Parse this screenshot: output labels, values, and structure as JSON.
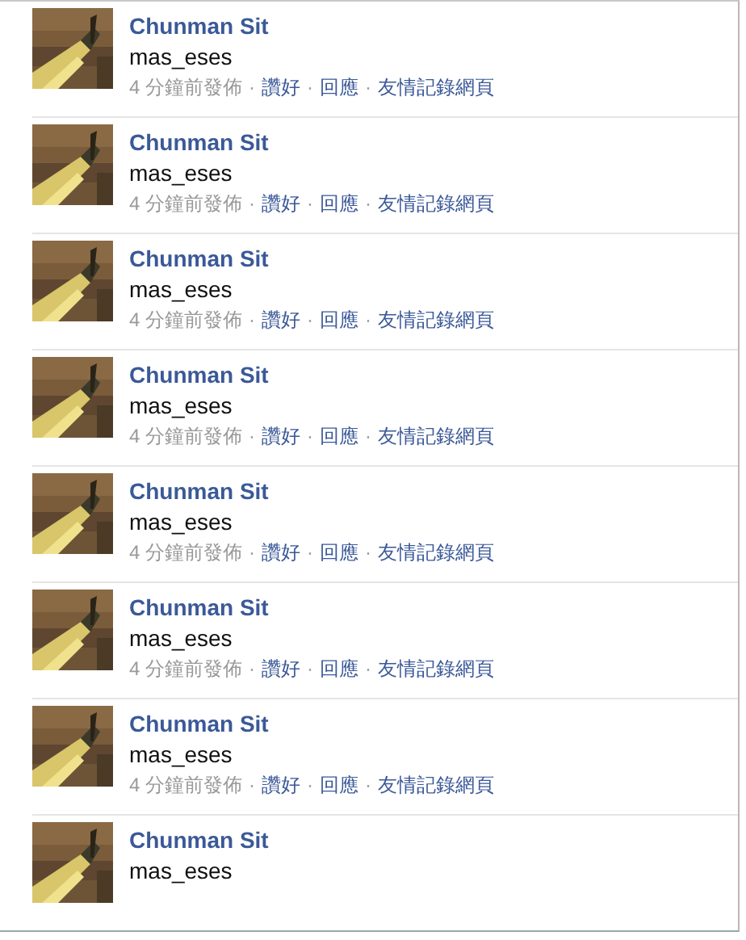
{
  "stories": [
    {
      "name": "Chunman Sit",
      "text": "mas_eses",
      "meta": [
        {
          "kind": "time",
          "text": "4 分鐘前發佈"
        },
        {
          "kind": "sep",
          "text": "·"
        },
        {
          "kind": "link",
          "text": "讚好"
        },
        {
          "kind": "sep",
          "text": "·"
        },
        {
          "kind": "link",
          "text": "回應"
        },
        {
          "kind": "sep",
          "text": "·"
        },
        {
          "kind": "link",
          "text": "友情記錄網頁"
        }
      ]
    },
    {
      "name": "Chunman Sit",
      "text": "mas_eses",
      "meta": [
        {
          "kind": "time",
          "text": "4 分鐘前發佈"
        },
        {
          "kind": "sep",
          "text": "·"
        },
        {
          "kind": "link",
          "text": "讚好"
        },
        {
          "kind": "sep",
          "text": "·"
        },
        {
          "kind": "link",
          "text": "回應"
        },
        {
          "kind": "sep",
          "text": "·"
        },
        {
          "kind": "link",
          "text": "友情記錄網頁"
        }
      ]
    },
    {
      "name": "Chunman Sit",
      "text": "mas_eses",
      "meta": [
        {
          "kind": "time",
          "text": "4 分鐘前發佈"
        },
        {
          "kind": "sep",
          "text": "·"
        },
        {
          "kind": "link",
          "text": "讚好"
        },
        {
          "kind": "sep",
          "text": "·"
        },
        {
          "kind": "link",
          "text": "回應"
        },
        {
          "kind": "sep",
          "text": "·"
        },
        {
          "kind": "link",
          "text": "友情記錄網頁"
        }
      ]
    },
    {
      "name": "Chunman Sit",
      "text": "mas_eses",
      "meta": [
        {
          "kind": "time",
          "text": "4 分鐘前發佈"
        },
        {
          "kind": "sep",
          "text": "·"
        },
        {
          "kind": "link",
          "text": "讚好"
        },
        {
          "kind": "sep",
          "text": "·"
        },
        {
          "kind": "link",
          "text": "回應"
        },
        {
          "kind": "sep",
          "text": "·"
        },
        {
          "kind": "link",
          "text": "友情記錄網頁"
        }
      ]
    },
    {
      "name": "Chunman Sit",
      "text": "mas_eses",
      "meta": [
        {
          "kind": "time",
          "text": "4 分鐘前發佈"
        },
        {
          "kind": "sep",
          "text": "·"
        },
        {
          "kind": "link",
          "text": "讚好"
        },
        {
          "kind": "sep",
          "text": "·"
        },
        {
          "kind": "link",
          "text": "回應"
        },
        {
          "kind": "sep",
          "text": "·"
        },
        {
          "kind": "link",
          "text": "友情記錄網頁"
        }
      ]
    },
    {
      "name": "Chunman Sit",
      "text": "mas_eses",
      "meta": [
        {
          "kind": "time",
          "text": "4 分鐘前發佈"
        },
        {
          "kind": "sep",
          "text": "·"
        },
        {
          "kind": "link",
          "text": "讚好"
        },
        {
          "kind": "sep",
          "text": "·"
        },
        {
          "kind": "link",
          "text": "回應"
        },
        {
          "kind": "sep",
          "text": "·"
        },
        {
          "kind": "link",
          "text": "友情記錄網頁"
        }
      ]
    },
    {
      "name": "Chunman Sit",
      "text": "mas_eses",
      "meta": [
        {
          "kind": "time",
          "text": "4 分鐘前發佈"
        },
        {
          "kind": "sep",
          "text": "·"
        },
        {
          "kind": "link",
          "text": "讚好"
        },
        {
          "kind": "sep",
          "text": "·"
        },
        {
          "kind": "link",
          "text": "回應"
        },
        {
          "kind": "sep",
          "text": "·"
        },
        {
          "kind": "link",
          "text": "友情記錄網頁"
        }
      ]
    },
    {
      "name": "Chunman Sit",
      "text": "mas_eses"
    }
  ]
}
